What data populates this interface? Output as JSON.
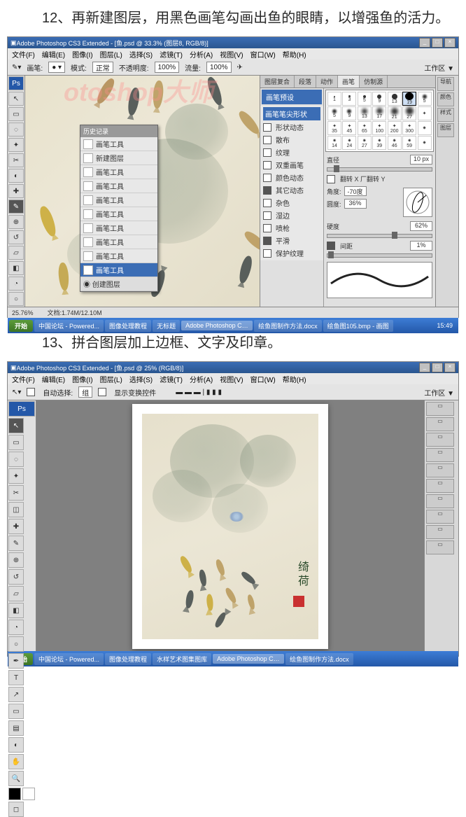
{
  "step12_text": "　　12、再新建图层，用黑色画笔勾画出鱼的眼睛，以增强鱼的活力。",
  "step13_text": "　　13、拼合图层加上边框、文字及印章。",
  "watermark": "otoshop大师",
  "ps1": {
    "title": "Adobe Photoshop CS3 Extended - [鱼.psd @ 33.3% (图层8, RGB/8)]",
    "menu": [
      "文件(F)",
      "编辑(E)",
      "图像(I)",
      "图层(L)",
      "选择(S)",
      "滤镜(T)",
      "分析(A)",
      "视图(V)",
      "窗口(W)",
      "帮助(H)"
    ],
    "opt_brush": "画笔:",
    "opt_mode": "模式:",
    "opt_mode_v": "正常",
    "opt_opacity": "不透明度:",
    "opt_opacity_v": "100%",
    "opt_flow": "流量:",
    "opt_flow_v": "100%",
    "opt_ws": "工作区 ▼",
    "flyout_title": "历史记录",
    "flyout": [
      {
        "l": "画笔工具"
      },
      {
        "l": "新建图层"
      },
      {
        "l": "画笔工具"
      },
      {
        "l": "画笔工具"
      },
      {
        "l": "画笔工具"
      },
      {
        "l": "画笔工具"
      },
      {
        "l": "画笔工具"
      },
      {
        "l": "画笔工具"
      },
      {
        "l": "画笔工具"
      },
      {
        "l": "画笔工具",
        "sel": true
      }
    ],
    "flyout_footer": "◉ 创建图层",
    "panel_tabs": [
      "图层复合",
      "段落",
      "动作",
      "画笔",
      "仿制源"
    ],
    "brush_preset": "画笔预设",
    "brush_sections": [
      {
        "l": "画笔笔尖形状",
        "sel": true
      },
      {
        "l": "形状动态",
        "cb": false
      },
      {
        "l": "散布",
        "cb": false
      },
      {
        "l": "纹理",
        "cb": false
      },
      {
        "l": "双重画笔",
        "cb": false
      },
      {
        "l": "颜色动态",
        "cb": false
      },
      {
        "l": "其它动态",
        "cb": true
      },
      {
        "l": "杂色",
        "cb": false
      },
      {
        "l": "湿边",
        "cb": false
      },
      {
        "l": "喷枪",
        "cb": false
      },
      {
        "l": "平滑",
        "cb": true
      },
      {
        "l": "保护纹理",
        "cb": false
      }
    ],
    "thumbs": [
      "1",
      "3",
      "5",
      "9",
      "13",
      "19",
      "5",
      "5",
      "9",
      "13",
      "17",
      "21",
      "27",
      "",
      "35",
      "45",
      "65",
      "100",
      "200",
      "300",
      "",
      "14",
      "24",
      "27",
      "39",
      "46",
      "59",
      ""
    ],
    "diameter_l": "直径",
    "diameter_v": "10 px",
    "flip_l": "翻转 X 厂翻转 Y",
    "angle_l": "角度:",
    "angle_v": "-70度",
    "round_l": "圆度:",
    "round_v": "36%",
    "hard_l": "硬度",
    "hard_v": "62%",
    "spacing_cb": "间距",
    "spacing_v": "1%",
    "far_right": [
      "导航",
      "颜色",
      "样式",
      "图层"
    ],
    "status_zoom": "25.76%",
    "status_doc": "文档:1.74M/12.10M",
    "taskbar": {
      "start": "开始",
      "items": [
        "中国论坛 - Powered...",
        "图像处理教程",
        "无标题",
        "Adobe Photoshop CS3",
        "绘鱼图制作方法.docx",
        "绘鱼图105.bmp - 画图"
      ],
      "time": "15:49"
    }
  },
  "ps2": {
    "title": "Adobe Photoshop CS3 Extended - [鱼.psd @ 25% (RGB/8)]",
    "menu": [
      "文件(F)",
      "编辑(E)",
      "图像(I)",
      "图层(L)",
      "选择(S)",
      "滤镜(T)",
      "分析(A)",
      "视图(V)",
      "窗口(W)",
      "帮助(H)"
    ],
    "opt1": "自动选择:",
    "opt1v": "组",
    "opt2": "显示变换控件",
    "opt_ws": "工作区 ▼",
    "signature": "绮\n荷",
    "taskbar": {
      "start": "开始",
      "items": [
        "中国论坛 - Powered...",
        "图像处理教程",
        "水样艺术图集图库",
        "Adobe Photoshop CS3",
        "绘鱼图制作方法.docx"
      ],
      "time": ""
    }
  }
}
